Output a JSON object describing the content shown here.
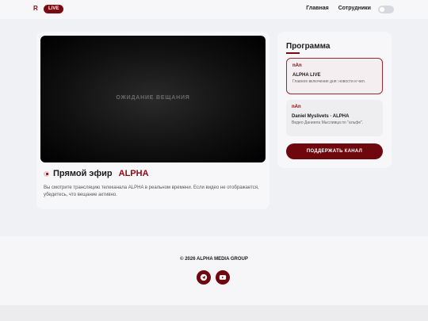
{
  "header": {
    "logo": "R",
    "live_badge": "LIVE",
    "nav": [
      "Главная",
      "Сотрудники"
    ]
  },
  "player": {
    "status": "ОЖИДАНИЕ ВЕЩАНИЯ",
    "title_prefix": "Прямой эфир",
    "title_brand": "ALPHA",
    "description": "Вы смотрите трансляцию телеканала ALPHA в реальном времени. Если видео не отображается, убедитесь, что вещание активно."
  },
  "program": {
    "title": "Программа",
    "items": [
      {
        "time": "nAn",
        "name": "ALPHA LIVE",
        "description": "Главное включение дня: новости и чил."
      },
      {
        "time": "nAn",
        "name": "Daniel Myslivets · ALPHA",
        "description": "Видео Даниила Мысливца по \"альфе\"."
      }
    ],
    "support_button": "ПОДДЕРЖАТЬ КАНАЛ"
  },
  "footer": {
    "copyright": "© 2026 ALPHA MEDIA GROUP",
    "socials": [
      "telegram-icon",
      "youtube-icon"
    ]
  },
  "colors": {
    "accent": "#7a0a10",
    "background": "#f0f1f4",
    "card": "#f7f7f9"
  }
}
